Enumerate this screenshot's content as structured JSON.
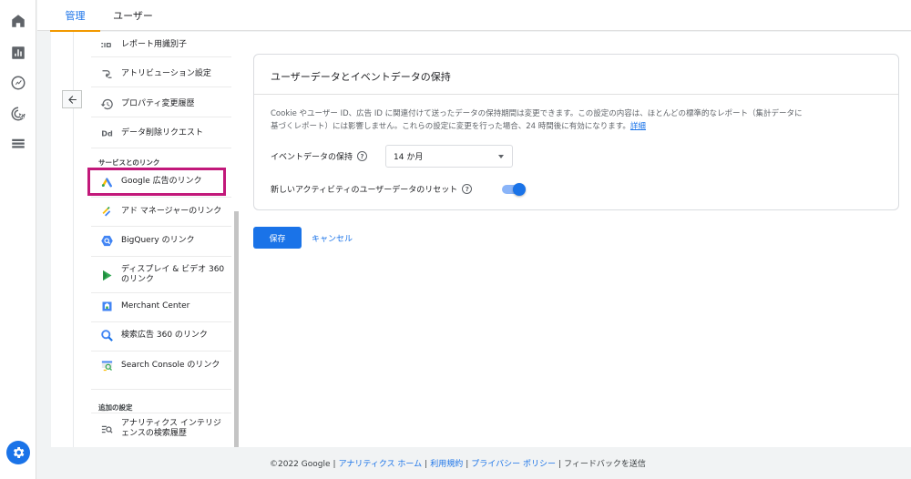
{
  "tabs": {
    "admin": "管理",
    "user": "ユーザー"
  },
  "menu": {
    "items_top": [
      {
        "label": "レポート用識別子",
        "icon": "identifier-icon"
      },
      {
        "label": "アトリビューション設定",
        "icon": "attribution-icon"
      },
      {
        "label": "プロパティ変更履歴",
        "icon": "history-icon"
      },
      {
        "label": "データ削除リクエスト",
        "icon": "data-deletion-icon"
      }
    ],
    "section_links": "サービスとのリンク",
    "items_links": [
      {
        "label": "Google 広告のリンク",
        "icon": "google-ads-icon"
      },
      {
        "label": "アド マネージャーのリンク",
        "icon": "ad-manager-icon"
      },
      {
        "label": "BigQuery のリンク",
        "icon": "bigquery-icon"
      },
      {
        "label1": "ディスプレイ & ビデオ 360",
        "label2": "のリンク",
        "icon": "display-video-360-icon"
      },
      {
        "label": "Merchant Center",
        "icon": "merchant-center-icon"
      },
      {
        "label": "検索広告 360 のリンク",
        "icon": "search-ads-360-icon"
      },
      {
        "label": "Search Console のリンク",
        "icon": "search-console-icon"
      }
    ],
    "section_additional": "追加の設定",
    "items_additional": [
      {
        "label1": "アナリティクス インテリジ",
        "label2": "ェンスの検索履歴",
        "icon": "intelligence-search-icon"
      }
    ]
  },
  "card": {
    "title": "ユーザーデータとイベントデータの保持",
    "desc_line1": "Cookie やユーザー ID、広告 ID に関連付けて送ったデータの保持期間は変更できます。この設定の内容は、ほとんどの標準的なレポート（集計データに",
    "desc_line2": "基づくレポート）には影響しません。これらの設定に変更を行った場合、24 時間後に有効になります。",
    "desc_link": "詳細",
    "event_retention_label": "イベントデータの保持",
    "event_retention_value": "14 か月",
    "reset_label": "新しいアクティビティのユーザーデータのリセット",
    "reset_enabled": true
  },
  "actions": {
    "save": "保存",
    "cancel": "キャンセル"
  },
  "footer": {
    "copyright": "©2022 Google",
    "analytics_home": "アナリティクス ホーム",
    "terms": "利用規約",
    "privacy": "プライバシー ポリシー",
    "feedback": "フィードバックを送信"
  },
  "colors": {
    "accent": "#1a73e8",
    "highlight": "#c2187a",
    "tab_underline": "#f29900"
  }
}
